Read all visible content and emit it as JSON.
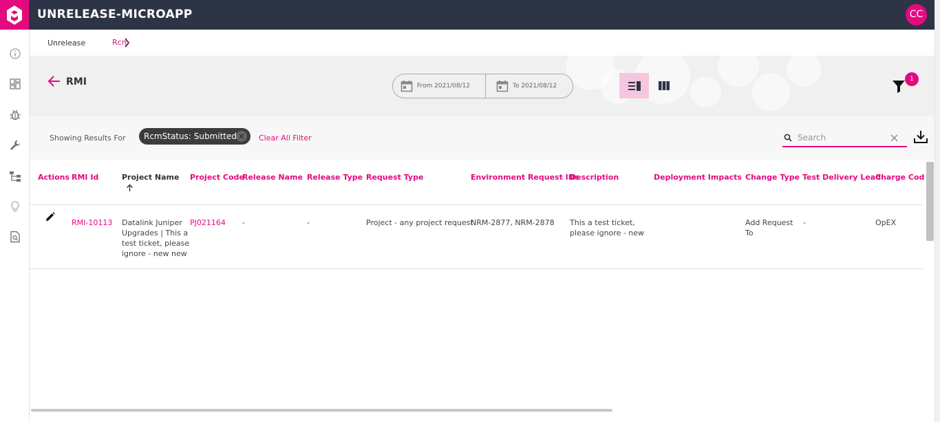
{
  "app": {
    "title": "UNRELEASE-MICROAPP",
    "avatar_initials": "CC",
    "brand_color": "#e5097f",
    "topbar_color": "#2d3446"
  },
  "sidebar": {
    "icons": [
      "info-icon",
      "dashboard-icon",
      "bug-icon",
      "wrench-icon",
      "hierarchy-icon",
      "lightbulb-icon",
      "document-search-icon"
    ]
  },
  "breadcrumb": {
    "items": [
      "Unrelease",
      "Rcm"
    ]
  },
  "header": {
    "title": "RMI",
    "date_from": "From 2021/08/12",
    "date_to": "To 2021/08/12",
    "filter_count": "1"
  },
  "filters": {
    "showing_label": "Showing Results For",
    "chip_label": "RcmStatus: Submitted",
    "clear_label": "Clear All Filter",
    "search_placeholder": "Search"
  },
  "table": {
    "columns": [
      "Actions",
      "RMI Id",
      "Project Name",
      "Project Code",
      "Release Name",
      "Release Type",
      "Request Type",
      "Environment Request IDs",
      "Description",
      "Deployment Impacts",
      "Change Type",
      "Test Delivery Lead",
      "Charge Code"
    ],
    "rows": [
      {
        "rmi_id": "RMI-10113",
        "project_name": [
          "Datalink Juniper",
          "Upgrades | This a",
          "test ticket, please",
          "ignore - new new"
        ],
        "project_code": "PJ021164",
        "release_name": "-",
        "release_type": "-",
        "request_type": "Project - any project request",
        "env_request_ids": "NRM-2877, NRM-2878",
        "description": [
          "This a test ticket,",
          "please ignore - new"
        ],
        "deployment_impacts": "",
        "change_type": [
          "Add Request",
          "To"
        ],
        "test_delivery_lead": "-",
        "charge_code": "OpEX"
      }
    ]
  }
}
